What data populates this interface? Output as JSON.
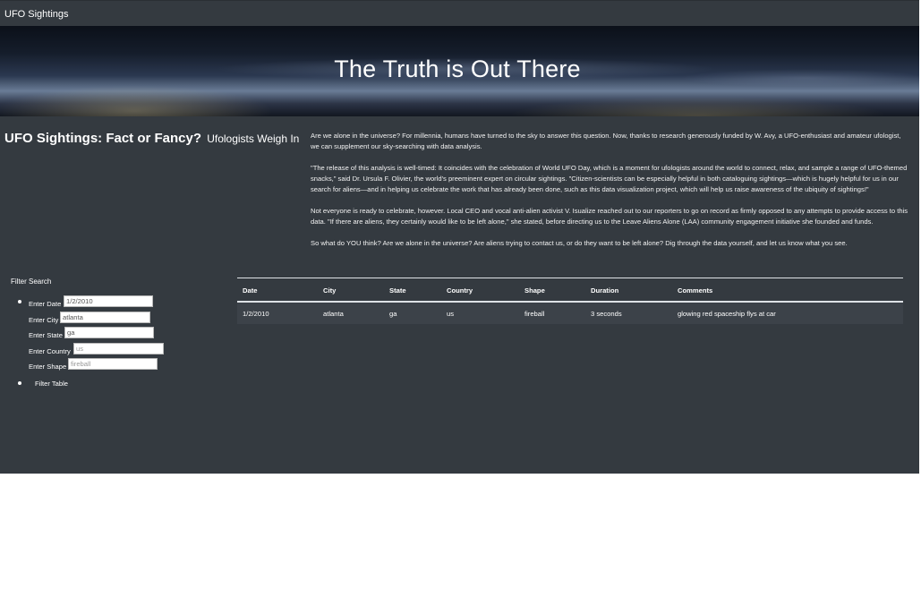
{
  "navbar": {
    "brand": "UFO Sightings"
  },
  "hero": {
    "title": "The Truth is Out There"
  },
  "intro": {
    "headline": "UFO Sightings: Fact or Fancy?",
    "subheadline": "Ufologists Weigh In",
    "paragraphs": [
      "Are we alone in the universe? For millennia, humans have turned to the sky to answer this question. Now, thanks to research generously funded by W. Avy, a UFO-enthusiast and amateur ufologist, we can supplement our sky-searching with data analysis.",
      "\"The release of this analysis is well-timed: It coincides with the celebration of World UFO Day, which is a moment for ufologists around the world to connect, relax, and sample a range of UFO-themed snacks,\" said Dr. Ursula F. Olivier, the world's preeminent expert on circular sightings. \"Citizen-scientists can be especially helpful in both cataloguing sightings—which is hugely helpful for us in our search for aliens—and in helping us celebrate the work that has already been done, such as this data visualization project, which will help us raise awareness of the ubiquity of sightings!\"",
      "Not everyone is ready to celebrate, however. Local CEO and vocal anti-alien activist V. Isualize reached out to our reporters to go on record as firmly opposed to any attempts to provide access to this data. \"If there are aliens, they certainly would like to be left alone,\" she stated, before directing us to the Leave Aliens Alone (LAA) community engagement initiative she founded and funds.",
      "So what do YOU think? Are we alone in the universe? Are aliens trying to contact us, or do they want to be left alone? Dig through the data yourself, and let us know what you see."
    ]
  },
  "filters": {
    "title": "Filter Search",
    "date": {
      "label": "Enter Date",
      "value": "1/2/2010"
    },
    "city": {
      "label": "Enter City",
      "value": "atlanta"
    },
    "state": {
      "label": "Enter State",
      "value": "ga"
    },
    "country": {
      "label": "Enter Country",
      "value": "",
      "placeholder": "us"
    },
    "shape": {
      "label": "Enter Shape",
      "value": "",
      "placeholder": "fireball"
    },
    "button": "Filter Table"
  },
  "table": {
    "headers": [
      "Date",
      "City",
      "State",
      "Country",
      "Shape",
      "Duration",
      "Comments"
    ],
    "rows": [
      [
        "1/2/2010",
        "atlanta",
        "ga",
        "us",
        "fireball",
        "3 seconds",
        "glowing red spaceship flys at car"
      ]
    ]
  }
}
